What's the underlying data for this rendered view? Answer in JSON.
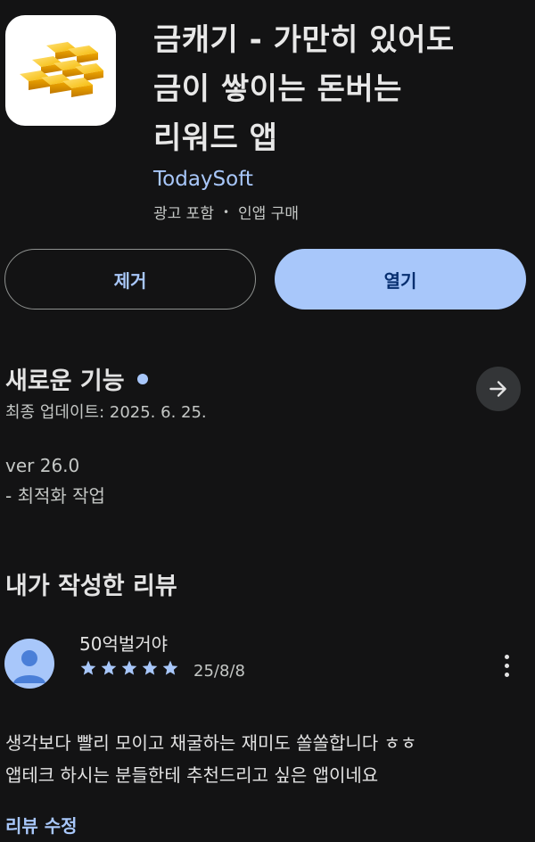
{
  "app": {
    "title_lines": [
      "금캐기 - 가만히 있어도",
      "금이 쌓이는 돈버는",
      "리워드 앱"
    ],
    "developer": "TodaySoft",
    "ads": "광고 포함",
    "separator": "•",
    "iap": "인앱 구매",
    "icon": "gold-bars-icon"
  },
  "actions": {
    "uninstall_label": "제거",
    "open_label": "열기"
  },
  "whats_new": {
    "title": "새로운 기능",
    "updated": "최종 업데이트: 2025. 6. 25.",
    "notes": [
      "ver 26.0",
      "- 최적화 작업"
    ]
  },
  "my_review": {
    "title": "내가 작성한 리뷰",
    "reviewer": "50억벌거야",
    "rating": 5,
    "max_rating": 5,
    "date": "25/8/8",
    "text_lines": [
      "생각보다 빨리 모이고 채굴하는 재미도 쏠쏠합니다 ㅎㅎ",
      "앱테크 하시는 분들한테 추천드리고 싶은 앱이네요"
    ],
    "edit_label": "리뷰 수정"
  },
  "colors": {
    "background": "#131314",
    "accent": "#a8c7fa",
    "open_text": "#062e6f"
  }
}
